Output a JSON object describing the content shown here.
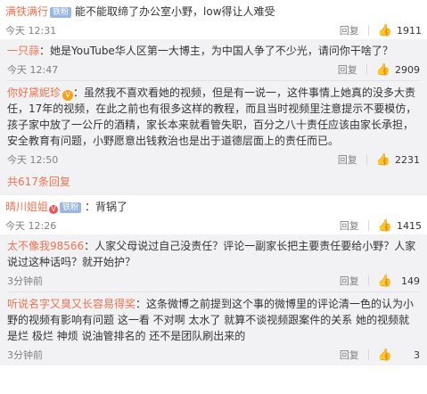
{
  "comments": [
    {
      "author": "满铁满行",
      "badge": "铁粉",
      "text": "能不能取缔了办公室小野，low得让人难受",
      "time": "今天 12:31",
      "reply": "回复",
      "likes": "1911"
    },
    {
      "author": "一只蒜",
      "text": "：她是YouTube华人区第一大博主，为中国人争了不少光，请问你干啥了？",
      "time": "今天 12:47",
      "reply": "回复",
      "likes": "2909"
    },
    {
      "author": "你好黛妮珍",
      "text": "：虽然我不喜欢看她的视频，但是有一说一，这件事情上她真的没多大责任，17年的视频，在此之前也有很多这样的教程，而且当时视频里注意提示不要模仿，孩子家中放了一公斤的酒精，家长本来就看管失职，百分之八十责任应该由家长承担，安全教育有问题，小野愿意出钱救治也是出于道德层面上的责任而已。",
      "time": "今天 12:50",
      "reply": "回复",
      "likes": "2231"
    },
    {
      "more": "共617条回复"
    },
    {
      "author": "晴川姐姐",
      "badge": "铁粉",
      "text": "：背锅了",
      "time": "今天 12:26",
      "reply": "回复",
      "likes": "1415"
    },
    {
      "author": "太不像我98566",
      "text": "：人家父母说过自己没责任？评论一副家长把主要责任要给小野？人家说过这种话吗？就开始护？",
      "time": "3分钟前",
      "reply": "回复",
      "likes": "149"
    },
    {
      "author": "听说名字又臭又长容易得奖",
      "text": "：这条微博之前提到这个事的微博里的评论清一色的认为小野的视频有影响有问题 这一看 不对啊 太水了 就算不谈视频跟案件的关系 她的视频就是烂 极烂 神烦 说油管排名的 还不是团队刷出来的",
      "time": "3分钟前",
      "reply": "回复",
      "likes": "3"
    }
  ]
}
